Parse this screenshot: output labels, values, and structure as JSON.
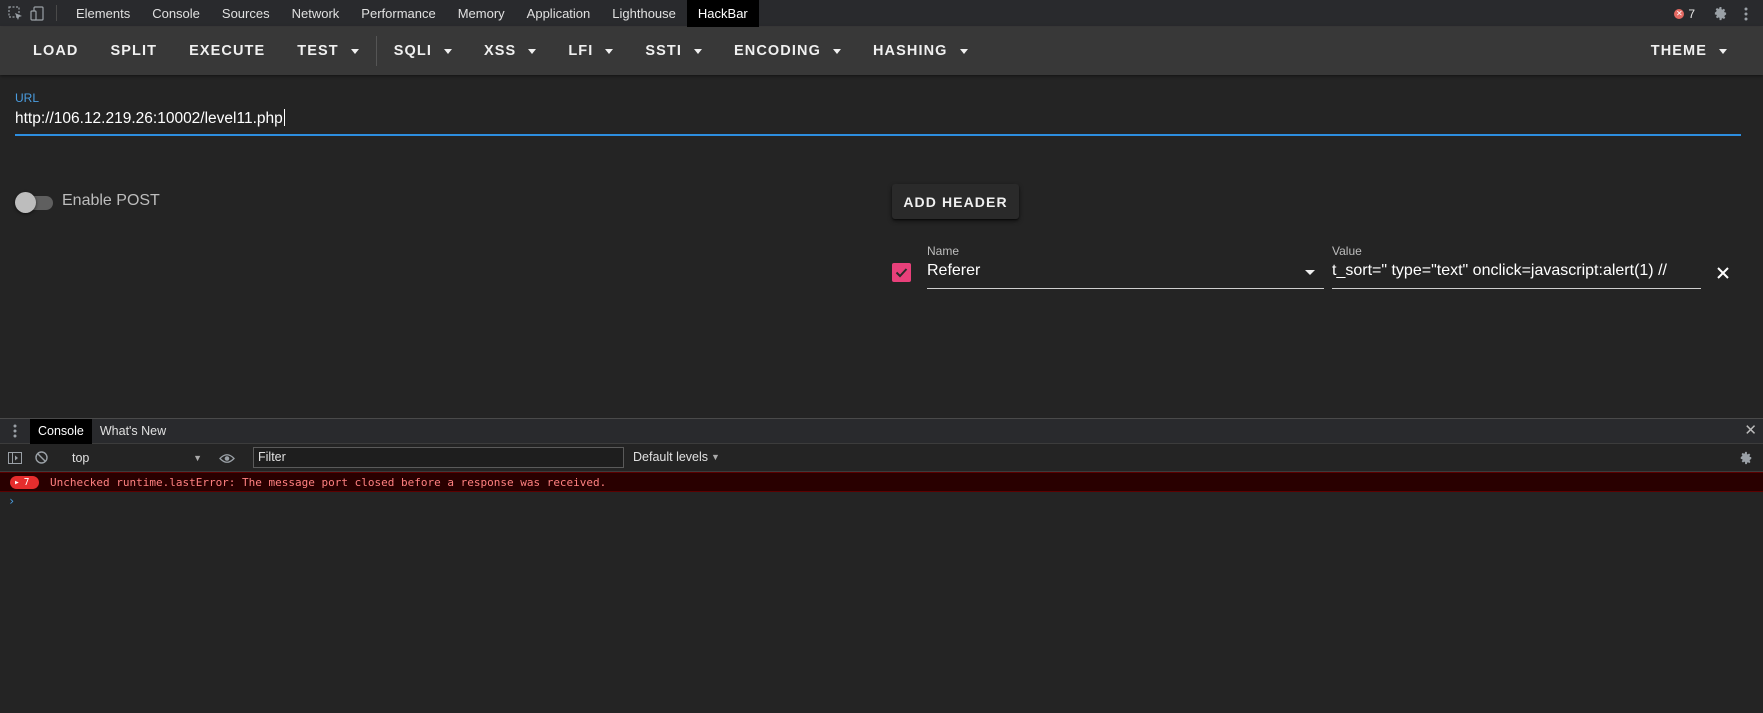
{
  "devtools": {
    "tabs": [
      "Elements",
      "Console",
      "Sources",
      "Network",
      "Performance",
      "Memory",
      "Application",
      "Lighthouse",
      "HackBar"
    ],
    "active_tab": "HackBar",
    "error_count": "7",
    "icons": [
      "inspect-icon",
      "device-toolbar-icon",
      "error-icon",
      "gear-icon",
      "more-vert-icon"
    ]
  },
  "hackbar": {
    "toolbar": {
      "load": "LOAD",
      "split": "SPLIT",
      "execute": "EXECUTE",
      "test": "TEST",
      "sqli": "SQLI",
      "xss": "XSS",
      "lfi": "LFI",
      "ssti": "SSTI",
      "encoding": "ENCODING",
      "hashing": "HASHING",
      "theme": "THEME"
    },
    "url": {
      "label": "URL",
      "value": "http://106.12.219.26:10002/level11.php"
    },
    "enable_post": {
      "label": "Enable POST",
      "enabled": false
    },
    "add_header_label": "ADD HEADER",
    "header": {
      "enabled": true,
      "name_label": "Name",
      "name_value": "Referer",
      "value_label": "Value",
      "value_value": "t_sort=\" type=\"text\" onclick=javascript:alert(1) //"
    },
    "accent_color": "#2d8ee0",
    "checkbox_color": "#e8407a"
  },
  "console_drawer": {
    "tabs": [
      "Console",
      "What's New"
    ],
    "active_tab": "Console",
    "context": "top",
    "filter_placeholder": "Filter",
    "levels": "Default levels",
    "messages": [
      {
        "level": "error",
        "count": "7",
        "text": "Unchecked runtime.lastError: The message port closed before a response was received."
      }
    ],
    "prompt": "›"
  }
}
